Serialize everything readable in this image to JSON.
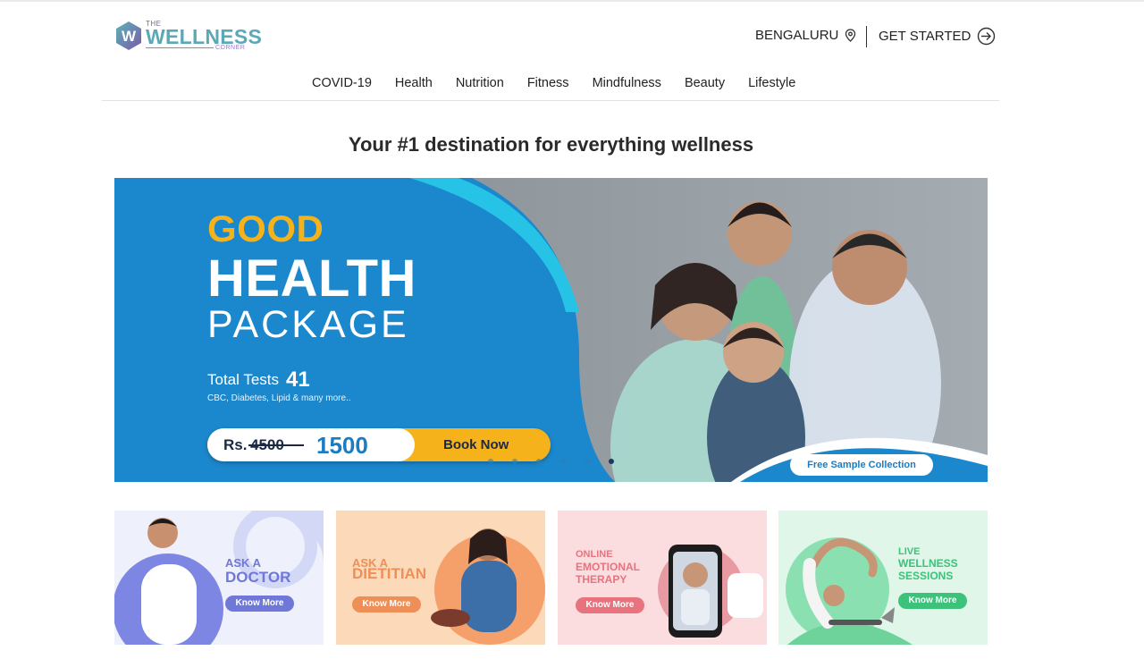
{
  "logo": {
    "the": "THE",
    "main": "WELLNESS",
    "corner": "CORNER",
    "mark_letter": "W"
  },
  "header": {
    "city": "BENGALURU",
    "cta": "GET STARTED",
    "icons": {
      "location": "location-pin-icon",
      "cta": "arrow-right-circle-icon"
    }
  },
  "nav": {
    "items": [
      "COVID-19",
      "Health",
      "Nutrition",
      "Fitness",
      "Mindfulness",
      "Beauty",
      "Lifestyle"
    ]
  },
  "headline": "Your #1 destination for everything wellness",
  "banner": {
    "line1": "GOOD",
    "line2": "HEALTH",
    "line3": "PACKAGE",
    "total_label": "Total Tests",
    "total_value": "41",
    "tests_desc": "CBC, Diabetes, Lipid & many more..",
    "price_prefix": "Rs.",
    "price_old": "4500",
    "price_new": "1500",
    "book": "Book Now",
    "free": "Free Sample Collection",
    "slides": 6,
    "active_slide": 5,
    "colors": {
      "blue": "#1b87cc",
      "yellow": "#f5b21a",
      "cyan": "#27c3e6"
    }
  },
  "cards": [
    {
      "small": "ASK A",
      "big": "DOCTOR",
      "button": "Know More",
      "accent": "#6f78d9",
      "bg": "#eef0fb"
    },
    {
      "small": "ASK A",
      "big": "DIETITIAN",
      "button": "Know More",
      "accent": "#ee8f57",
      "bg": "#fcd9b8"
    },
    {
      "lines": [
        "ONLINE",
        "EMOTIONAL",
        "THERAPY"
      ],
      "button": "Know More",
      "accent": "#e8737e",
      "bg": "#fbdde0"
    },
    {
      "lines": [
        "LIVE",
        "WELLNESS",
        "SESSIONS"
      ],
      "button": "Know More",
      "accent": "#3cc27a",
      "bg": "#dff6e8"
    }
  ]
}
